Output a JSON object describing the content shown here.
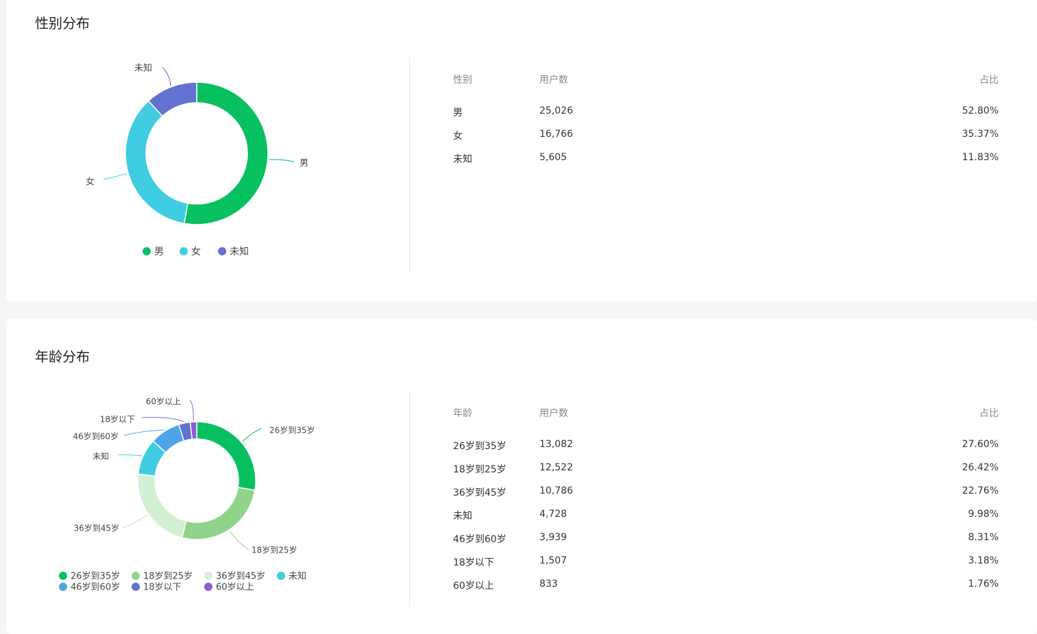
{
  "gender": {
    "title": "性别分布",
    "table": {
      "headers": [
        "性别",
        "用户数",
        "占比"
      ],
      "rows": [
        [
          "男",
          "25,026",
          "52.80%"
        ],
        [
          "女",
          "16,766",
          "35.37%"
        ],
        [
          "未知",
          "5,605",
          "11.83%"
        ]
      ]
    },
    "chart_data": {
      "type": "pie",
      "categories": [
        "男",
        "女",
        "未知"
      ],
      "values": [
        25026,
        16766,
        5605
      ],
      "colors": [
        "#07c160",
        "#40cde2",
        "#6272d1"
      ],
      "legend_position": "bottom"
    }
  },
  "age": {
    "title": "年龄分布",
    "table": {
      "headers": [
        "年龄",
        "用户数",
        "占比"
      ],
      "rows": [
        [
          "26岁到35岁",
          "13,082",
          "27.60%"
        ],
        [
          "18岁到25岁",
          "12,522",
          "26.42%"
        ],
        [
          "36岁到45岁",
          "10,786",
          "22.76%"
        ],
        [
          "未知",
          "4,728",
          "9.98%"
        ],
        [
          "46岁到60岁",
          "3,939",
          "8.31%"
        ],
        [
          "18岁以下",
          "1,507",
          "3.18%"
        ],
        [
          "60岁以上",
          "833",
          "1.76%"
        ]
      ]
    },
    "chart_data": {
      "type": "pie",
      "categories": [
        "26岁到35岁",
        "18岁到25岁",
        "36岁到45岁",
        "未知",
        "46岁到60岁",
        "18岁以下",
        "60岁以上"
      ],
      "values": [
        13082,
        12522,
        10786,
        4728,
        3939,
        1507,
        833
      ],
      "colors": [
        "#07c160",
        "#8fd48a",
        "#d2f0d4",
        "#40cde2",
        "#4fa3e8",
        "#6272d1",
        "#8e5bd6"
      ],
      "legend_position": "bottom"
    }
  }
}
